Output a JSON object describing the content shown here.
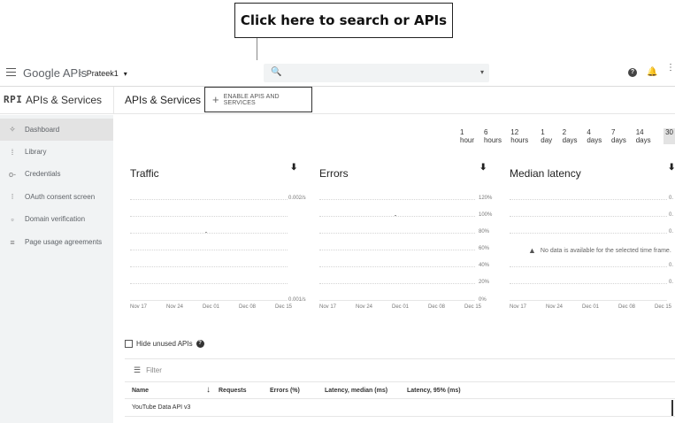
{
  "annotation": {
    "callout_text": "Click here to search or APIs"
  },
  "topbar": {
    "brand": "Google APIs",
    "project_dots": "⁘",
    "project": "Prateek1",
    "project_caret": "▾",
    "search_icon": "🔍",
    "search_caret": "▾",
    "help_icon": "?",
    "bell_icon": "🔔",
    "more_icon": "⋮"
  },
  "subheader": {
    "api_logo": "RPI",
    "section_title": "APIs & Services",
    "page_title": "APIs & Services",
    "enable_button_plus": "+",
    "enable_button": "ENABLE APIS AND SERVICES"
  },
  "sidebar": {
    "items": [
      {
        "icon": "✧",
        "label": "Dashboard",
        "active": true
      },
      {
        "icon": "⁞",
        "label": "Library"
      },
      {
        "icon": "o‑",
        "label": "Credentials"
      },
      {
        "icon": "⁝",
        "label": "OAuth consent screen"
      },
      {
        "icon": "▫",
        "label": "Domain verification"
      },
      {
        "icon": "≡",
        "label": "Page usage agreements"
      }
    ]
  },
  "time_filters": [
    "1 hour",
    "6 hours",
    "12 hours",
    "1 day",
    "2 days",
    "4 days",
    "7 days",
    "14 days",
    "30"
  ],
  "charts": {
    "download_icon": "⬇",
    "traffic": {
      "title": "Traffic",
      "y_ticks": [
        "0.002/s",
        "0.001/s"
      ],
      "x_ticks": [
        "Nov 17",
        "Nov 24",
        "Dec 01",
        "Dec 08",
        "Dec 15"
      ]
    },
    "errors": {
      "title": "Errors",
      "y_ticks": [
        "120%",
        "100%",
        "80%",
        "60%",
        "40%",
        "20%",
        "0%"
      ],
      "x_ticks": [
        "Nov 17",
        "Nov 24",
        "Dec 01",
        "Dec 08",
        "Dec 15"
      ]
    },
    "latency": {
      "title": "Median latency",
      "warning_icon": "▲",
      "no_data": "No data is available for the selected time frame.",
      "y_ticks": [
        "0.",
        "0.",
        "0.",
        "0.",
        "0."
      ],
      "x_ticks": [
        "Nov 17",
        "Nov 24",
        "Dec 01",
        "Dec 08",
        "Dec 15"
      ]
    }
  },
  "table": {
    "hide_unused_label": "Hide unused APIs",
    "hide_unused_help": "?",
    "filter_icon": "☰",
    "filter_placeholder": "Filter",
    "sort_arrow": "↓",
    "columns": [
      "Name",
      "Requests",
      "Errors (%)",
      "Latency, median (ms)",
      "Latency, 95% (ms)"
    ],
    "rows": [
      {
        "name": "YouTube Data API v3"
      }
    ]
  }
}
